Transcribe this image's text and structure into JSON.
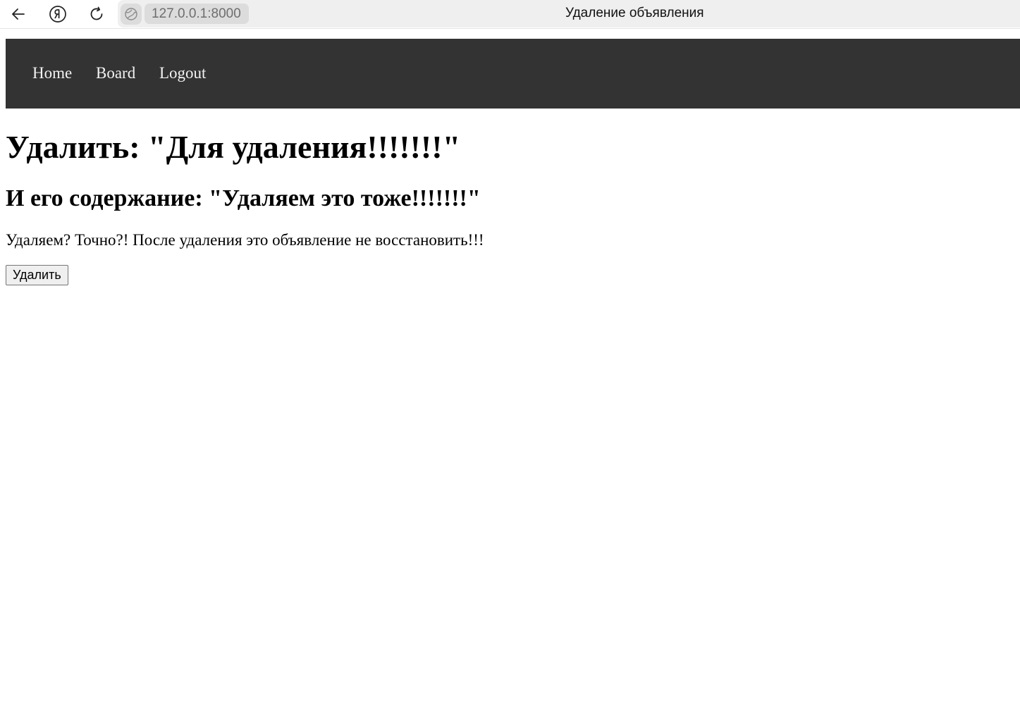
{
  "browser": {
    "url": "127.0.0.1:8000",
    "tab_title": "Удаление объявления",
    "icons": {
      "back": "arrow-left-icon",
      "yandex": "yandex-logo-icon",
      "reload": "reload-icon",
      "site": "globe-icon"
    }
  },
  "topnav": {
    "background": "#333333",
    "link_color": "#f2f2f2",
    "items": [
      {
        "label": "Home"
      },
      {
        "label": "Board"
      },
      {
        "label": "Logout"
      }
    ]
  },
  "content": {
    "heading": "Удалить: \"Для удаления!!!!!!!\"",
    "subheading": "И его содержание: \"Удаляем это тоже!!!!!!!\"",
    "confirm_text": "Удаляем? Точно?! После удаления это объявление не восстановить!!!",
    "submit_label": "Удалить"
  }
}
